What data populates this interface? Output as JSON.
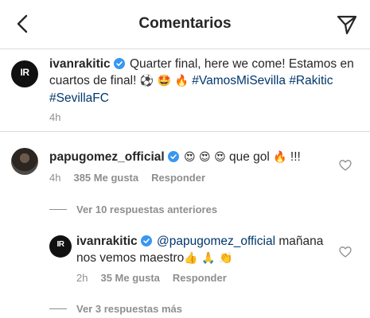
{
  "header": {
    "title": "Comentarios"
  },
  "caption": {
    "username": "ivanrakitic",
    "text_part1": "Quarter final, here we come! Estamos en cuartos de final!",
    "emojis": "⚽ 🤩 🔥",
    "hashtag1": "#VamosMiSevilla",
    "hashtag2": "#Rakitic",
    "hashtag3": "#SevillaFC",
    "time": "4h",
    "avatar_initials": "IR"
  },
  "comment": {
    "username": "papugomez_official",
    "emojis": "😍 😍 😍",
    "text": "que gol",
    "fire": "🔥",
    "suffix": "!!!",
    "time": "4h",
    "likes": "385 Me gusta",
    "reply_label": "Responder",
    "view_previous": "Ver 10 respuestas anteriores"
  },
  "reply": {
    "username": "ivanrakitic",
    "mention": "@papugomez_official",
    "text": "mañana nos vemos maestro",
    "emojis": "👍 🙏 👏",
    "time": "2h",
    "likes": "35 Me gusta",
    "reply_label": "Responder",
    "avatar_initials": "IR"
  },
  "more_replies": "Ver 3 respuestas más",
  "colors": {
    "verified": "#3897f0",
    "link": "#00376b",
    "secondary": "#8e8e8e"
  }
}
